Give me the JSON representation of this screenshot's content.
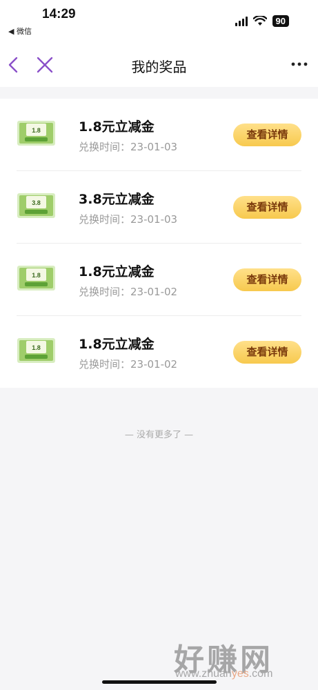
{
  "status_bar": {
    "time": "14:29",
    "back_app": "◀ 微信",
    "battery": "90"
  },
  "nav": {
    "title": "我的奖品"
  },
  "prizes": [
    {
      "name": "1.8元立减金",
      "thumb_value": "1.8",
      "date_label": "兑换时间：23-01-03",
      "button": "查看详情"
    },
    {
      "name": "3.8元立减金",
      "thumb_value": "3.8",
      "date_label": "兑换时间：23-01-03",
      "button": "查看详情"
    },
    {
      "name": "1.8元立减金",
      "thumb_value": "1.8",
      "date_label": "兑换时间：23-01-02",
      "button": "查看详情"
    },
    {
      "name": "1.8元立减金",
      "thumb_value": "1.8",
      "date_label": "兑换时间：23-01-02",
      "button": "查看详情"
    }
  ],
  "footer": {
    "no_more": "— 没有更多了 —"
  },
  "watermark": {
    "big": "好赚网",
    "url_pre": "www.zhuan",
    "url_hl": "yes",
    "url_post": ".com"
  },
  "colors": {
    "accent_purple": "#8a4fc9",
    "button_gold": "#f7c94e",
    "button_text": "#7a3a0c"
  },
  "icons": {
    "back": "chevron-left-icon",
    "close": "close-icon",
    "more": "more-horizontal-icon"
  }
}
